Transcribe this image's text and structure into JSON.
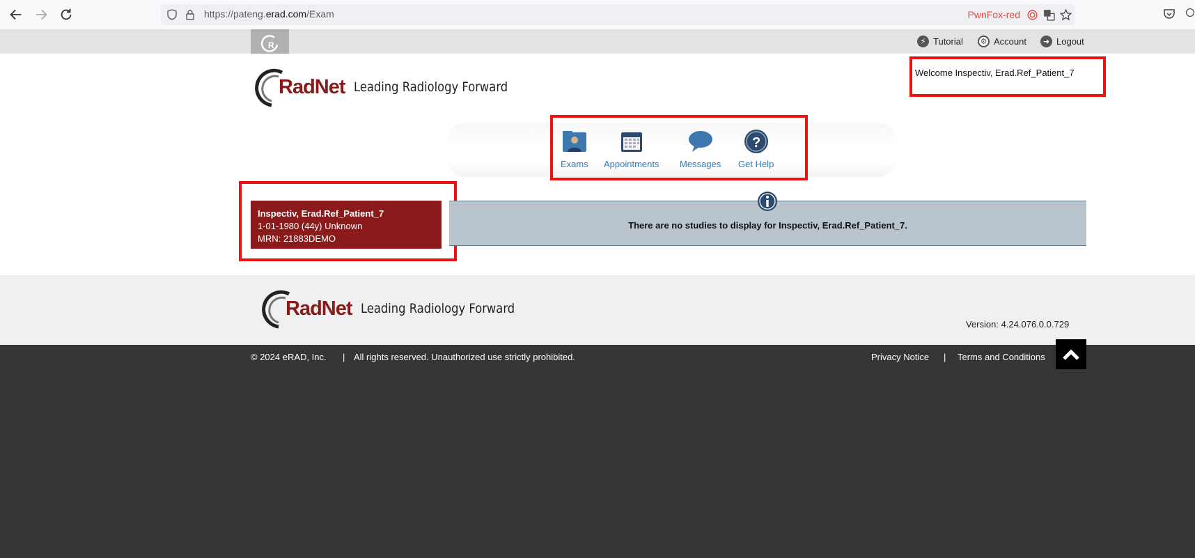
{
  "browser": {
    "url_prefix": "https://pateng.",
    "url_domain": "erad.com",
    "url_path": "/Exam",
    "container_label": "PwnFox-red"
  },
  "top_links": {
    "tutorial": "Tutorial",
    "account": "Account",
    "logout": "Logout"
  },
  "logo": {
    "brand": "RadNet",
    "tagline": "Leading Radiology Forward"
  },
  "welcome": "Welcome Inspectiv, Erad.Ref_Patient_7",
  "nav": {
    "exams": "Exams",
    "appointments": "Appointments",
    "messages": "Messages",
    "get_help": "Get Help"
  },
  "patient": {
    "name": "Inspectiv, Erad.Ref_Patient_7",
    "dob_line": "1-01-1980 (44y) Unknown",
    "mrn_line": "MRN: 21883DEMO"
  },
  "notice": "There are no studies to display for Inspectiv, Erad.Ref_Patient_7.",
  "footer": {
    "version": "Version: 4.24.076.0.0.729",
    "copyright": "© 2024 eRAD, Inc.",
    "sep1": "|",
    "rights": "All rights reserved. Unauthorized use strictly prohibited.",
    "privacy": "Privacy Notice",
    "sep2": "|",
    "terms": "Terms and Conditions"
  },
  "colors": {
    "brand_red": "#8c1a1a",
    "highlight_red": "#ee1111",
    "link_blue": "#2f7cc0",
    "notice_bg": "#b9c4cc",
    "footer_dark": "#353535"
  }
}
